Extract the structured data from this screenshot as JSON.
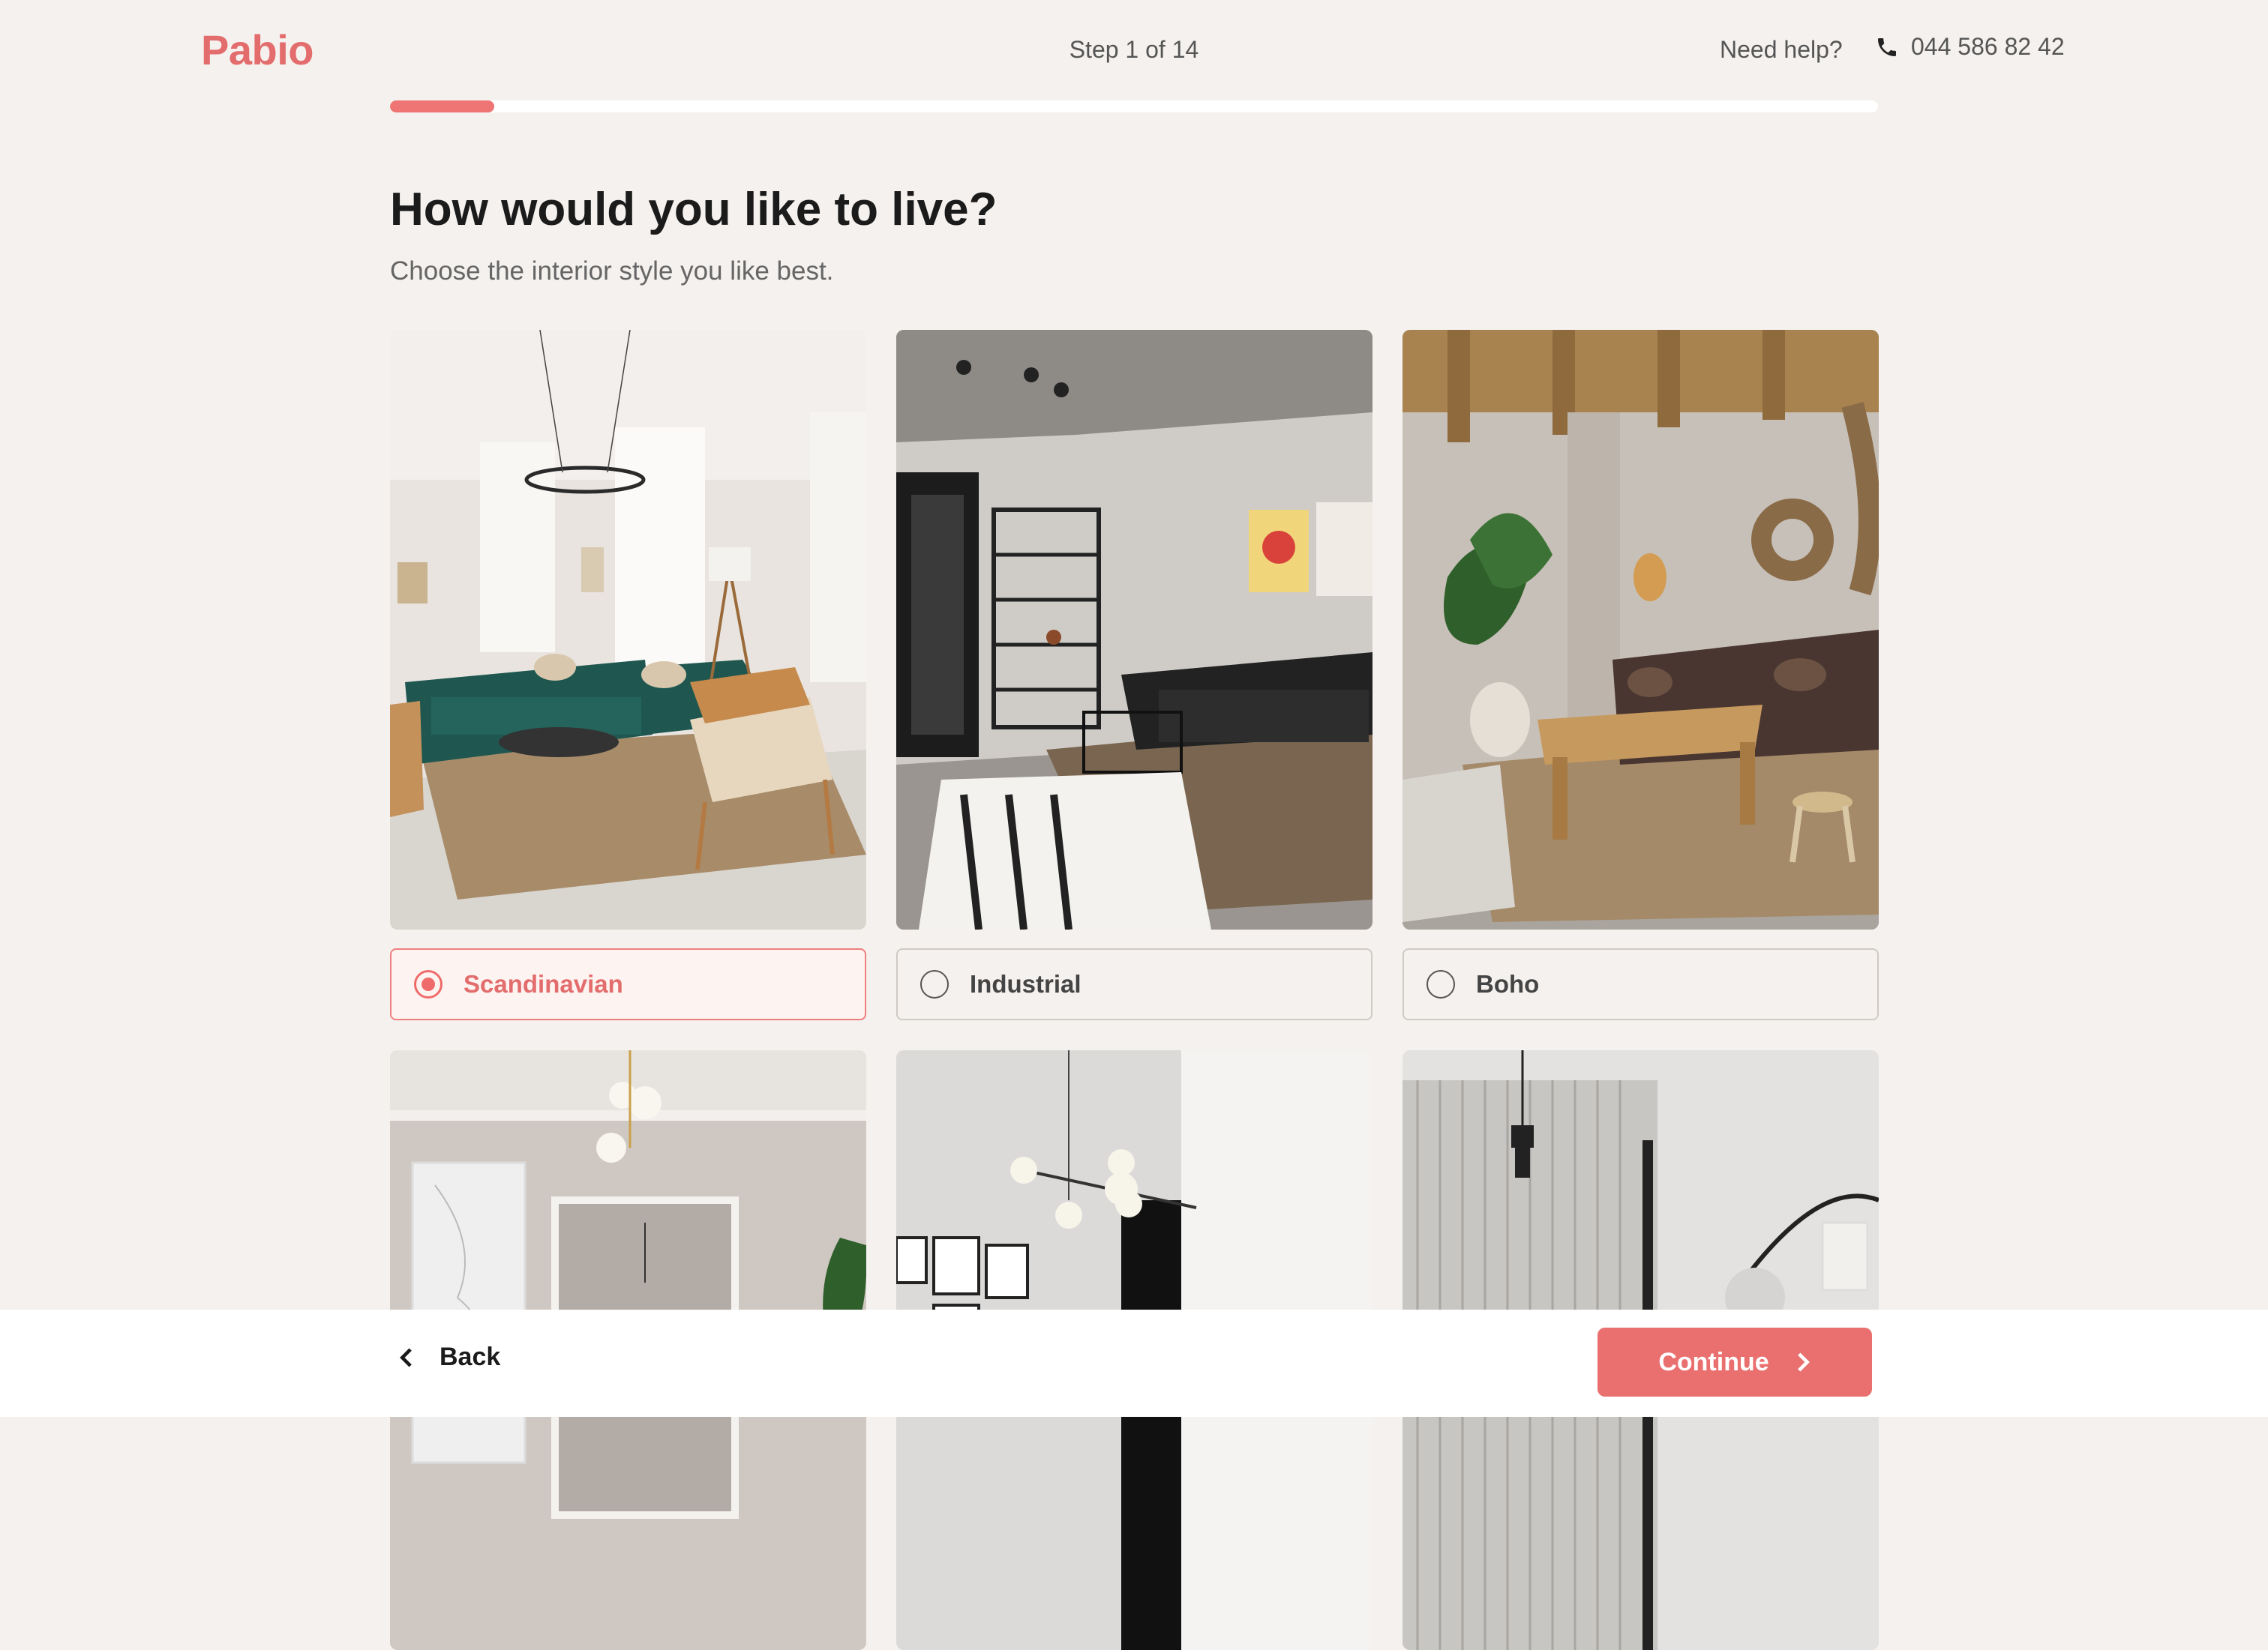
{
  "brand": {
    "logo": "Pabio",
    "accent": "#ea6f6f"
  },
  "header": {
    "step_text": "Step 1 of 14",
    "help_text": "Need help?",
    "phone": "044 586 82 42",
    "progress_fraction": 0.07
  },
  "question": {
    "title": "How would you like to live?",
    "subtitle": "Choose the interior style you like best."
  },
  "options": [
    {
      "label": "Scandinavian",
      "selected": true,
      "image": "scandinavian-living-room"
    },
    {
      "label": "Industrial",
      "selected": false,
      "image": "industrial-living-room"
    },
    {
      "label": "Boho",
      "selected": false,
      "image": "boho-living-room"
    },
    {
      "label": "",
      "selected": false,
      "image": "classic-room-partial"
    },
    {
      "label": "",
      "selected": false,
      "image": "modern-room-partial"
    },
    {
      "label": "",
      "selected": false,
      "image": "minimal-room-partial"
    }
  ],
  "footer": {
    "back_label": "Back",
    "continue_label": "Continue"
  }
}
